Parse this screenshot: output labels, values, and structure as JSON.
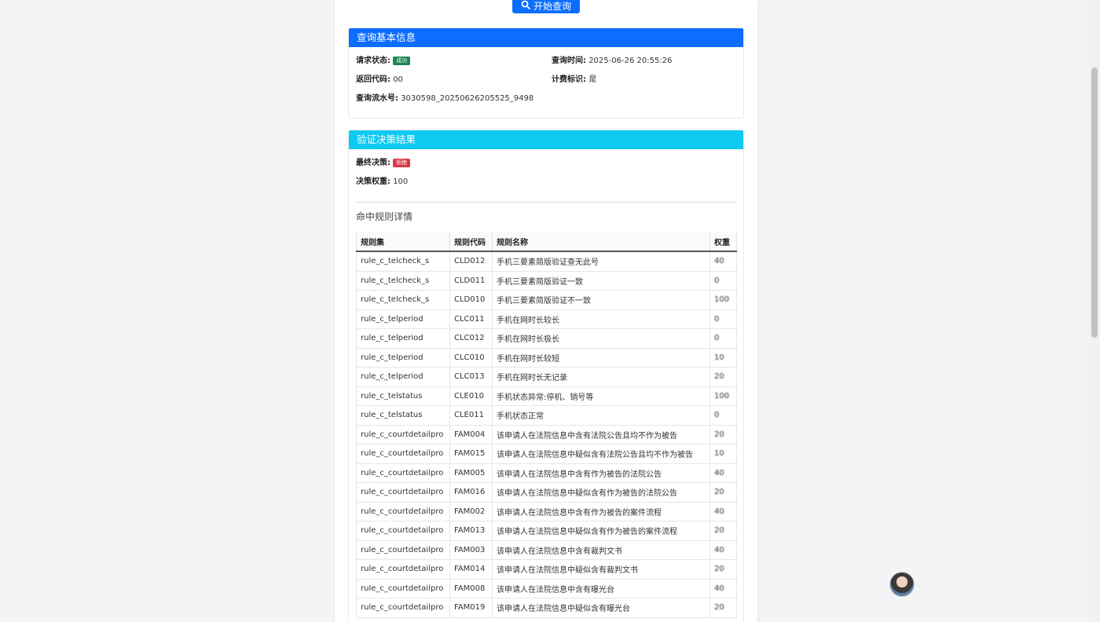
{
  "query_button": {
    "label": "开始查询"
  },
  "basic_info": {
    "title": "查询基本信息",
    "request_status_label": "请求状态:",
    "request_status_value": "成功",
    "query_time_label": "查询时间:",
    "query_time_value": "2025-06-26 20:55:26",
    "return_code_label": "返回代码:",
    "return_code_value": "00",
    "billing_label": "计费标识:",
    "billing_value": "是",
    "serial_label": "查询流水号:",
    "serial_value": "3030598_20250626205525_9498"
  },
  "decision": {
    "title": "验证决策结果",
    "final_label": "最终决策:",
    "final_value": "拒绝",
    "weight_label": "决策权重:",
    "weight_value": "100"
  },
  "rules_section": {
    "title": "命中规则详情",
    "columns": [
      "规则集",
      "规则代码",
      "规则名称",
      "权重"
    ],
    "rows": [
      [
        "rule_c_telcheck_s",
        "CLD012",
        "手机三要素简版验证查无此号",
        "40"
      ],
      [
        "rule_c_telcheck_s",
        "CLD011",
        "手机三要素简版验证一致",
        "0"
      ],
      [
        "rule_c_telcheck_s",
        "CLD010",
        "手机三要素简版验证不一致",
        "100"
      ],
      [
        "rule_c_telperiod",
        "CLC011",
        "手机在网时长较长",
        "0"
      ],
      [
        "rule_c_telperiod",
        "CLC012",
        "手机在网时长极长",
        "0"
      ],
      [
        "rule_c_telperiod",
        "CLC010",
        "手机在网时长较短",
        "10"
      ],
      [
        "rule_c_telperiod",
        "CLC013",
        "手机在网时长无记录",
        "20"
      ],
      [
        "rule_c_telstatus",
        "CLE010",
        "手机状态异常:停机、销号等",
        "100"
      ],
      [
        "rule_c_telstatus",
        "CLE011",
        "手机状态正常",
        "0"
      ],
      [
        "rule_c_courtdetailpro",
        "FAM004",
        "该申请人在法院信息中含有法院公告且均不作为被告",
        "20"
      ],
      [
        "rule_c_courtdetailpro",
        "FAM015",
        "该申请人在法院信息中疑似含有法院公告且均不作为被告",
        "10"
      ],
      [
        "rule_c_courtdetailpro",
        "FAM005",
        "该申请人在法院信息中含有作为被告的法院公告",
        "40"
      ],
      [
        "rule_c_courtdetailpro",
        "FAM016",
        "该申请人在法院信息中疑似含有作为被告的法院公告",
        "20"
      ],
      [
        "rule_c_courtdetailpro",
        "FAM002",
        "该申请人在法院信息中含有作为被告的案件流程",
        "40"
      ],
      [
        "rule_c_courtdetailpro",
        "FAM013",
        "该申请人在法院信息中疑似含有作为被告的案件流程",
        "20"
      ],
      [
        "rule_c_courtdetailpro",
        "FAM003",
        "该申请人在法院信息中含有裁判文书",
        "40"
      ],
      [
        "rule_c_courtdetailpro",
        "FAM014",
        "该申请人在法院信息中疑似含有裁判文书",
        "20"
      ],
      [
        "rule_c_courtdetailpro",
        "FAM008",
        "该申请人在法院信息中含有曝光台",
        "40"
      ],
      [
        "rule_c_courtdetailpro",
        "FAM019",
        "该申请人在法院信息中疑似含有曝光台",
        "20"
      ]
    ]
  },
  "colors": {
    "primary": "#0d6efd",
    "info": "#0dcaf0",
    "success": "#198754",
    "danger": "#dc3545"
  },
  "icons": {
    "query_button_icon": "search-icon"
  }
}
